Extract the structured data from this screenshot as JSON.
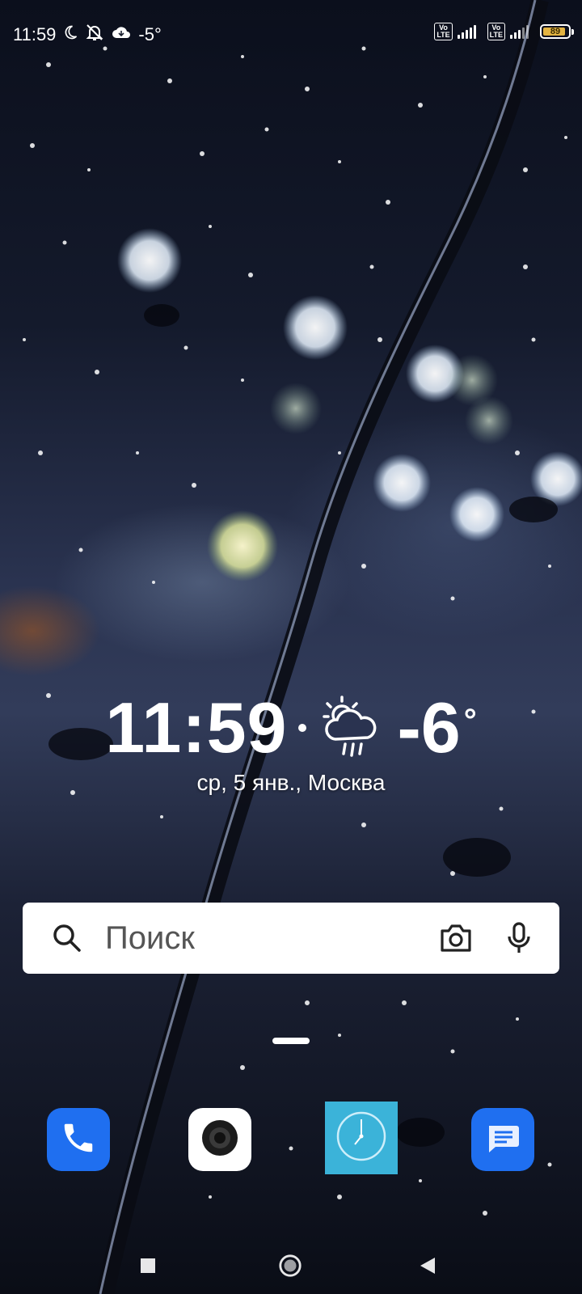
{
  "status_bar": {
    "time": "11:59",
    "temperature": "-5°",
    "sim1_label": "Vo\nLTE",
    "sim2_label": "Vo\nLTE",
    "battery_percent": "89",
    "battery_level": 0.89,
    "battery_color": "#e3b341",
    "icons": [
      "moon-icon",
      "notifications-off-icon",
      "cloud-icon"
    ]
  },
  "clock_widget": {
    "time": "11:59",
    "temperature": "-6",
    "degree": "°",
    "weather_icon": "partly-cloudy-rain-icon",
    "date_location": "ср, 5 янв.,  Москва"
  },
  "search": {
    "placeholder": "Поиск",
    "icons": [
      "search-icon",
      "camera-icon",
      "microphone-icon"
    ]
  },
  "dock": {
    "apps": [
      {
        "name": "phone",
        "icon": "phone-icon",
        "color": "#1f6ff0"
      },
      {
        "name": "camera",
        "icon": "camera-lens-icon",
        "color": "#ffffff"
      },
      {
        "name": "clock",
        "icon": "clock-icon",
        "color": "#3bb3d9"
      },
      {
        "name": "messages",
        "icon": "message-icon",
        "color": "#1f6ff0"
      }
    ]
  },
  "nav_bar": {
    "buttons": [
      "recents-icon",
      "home-icon",
      "back-icon"
    ]
  }
}
